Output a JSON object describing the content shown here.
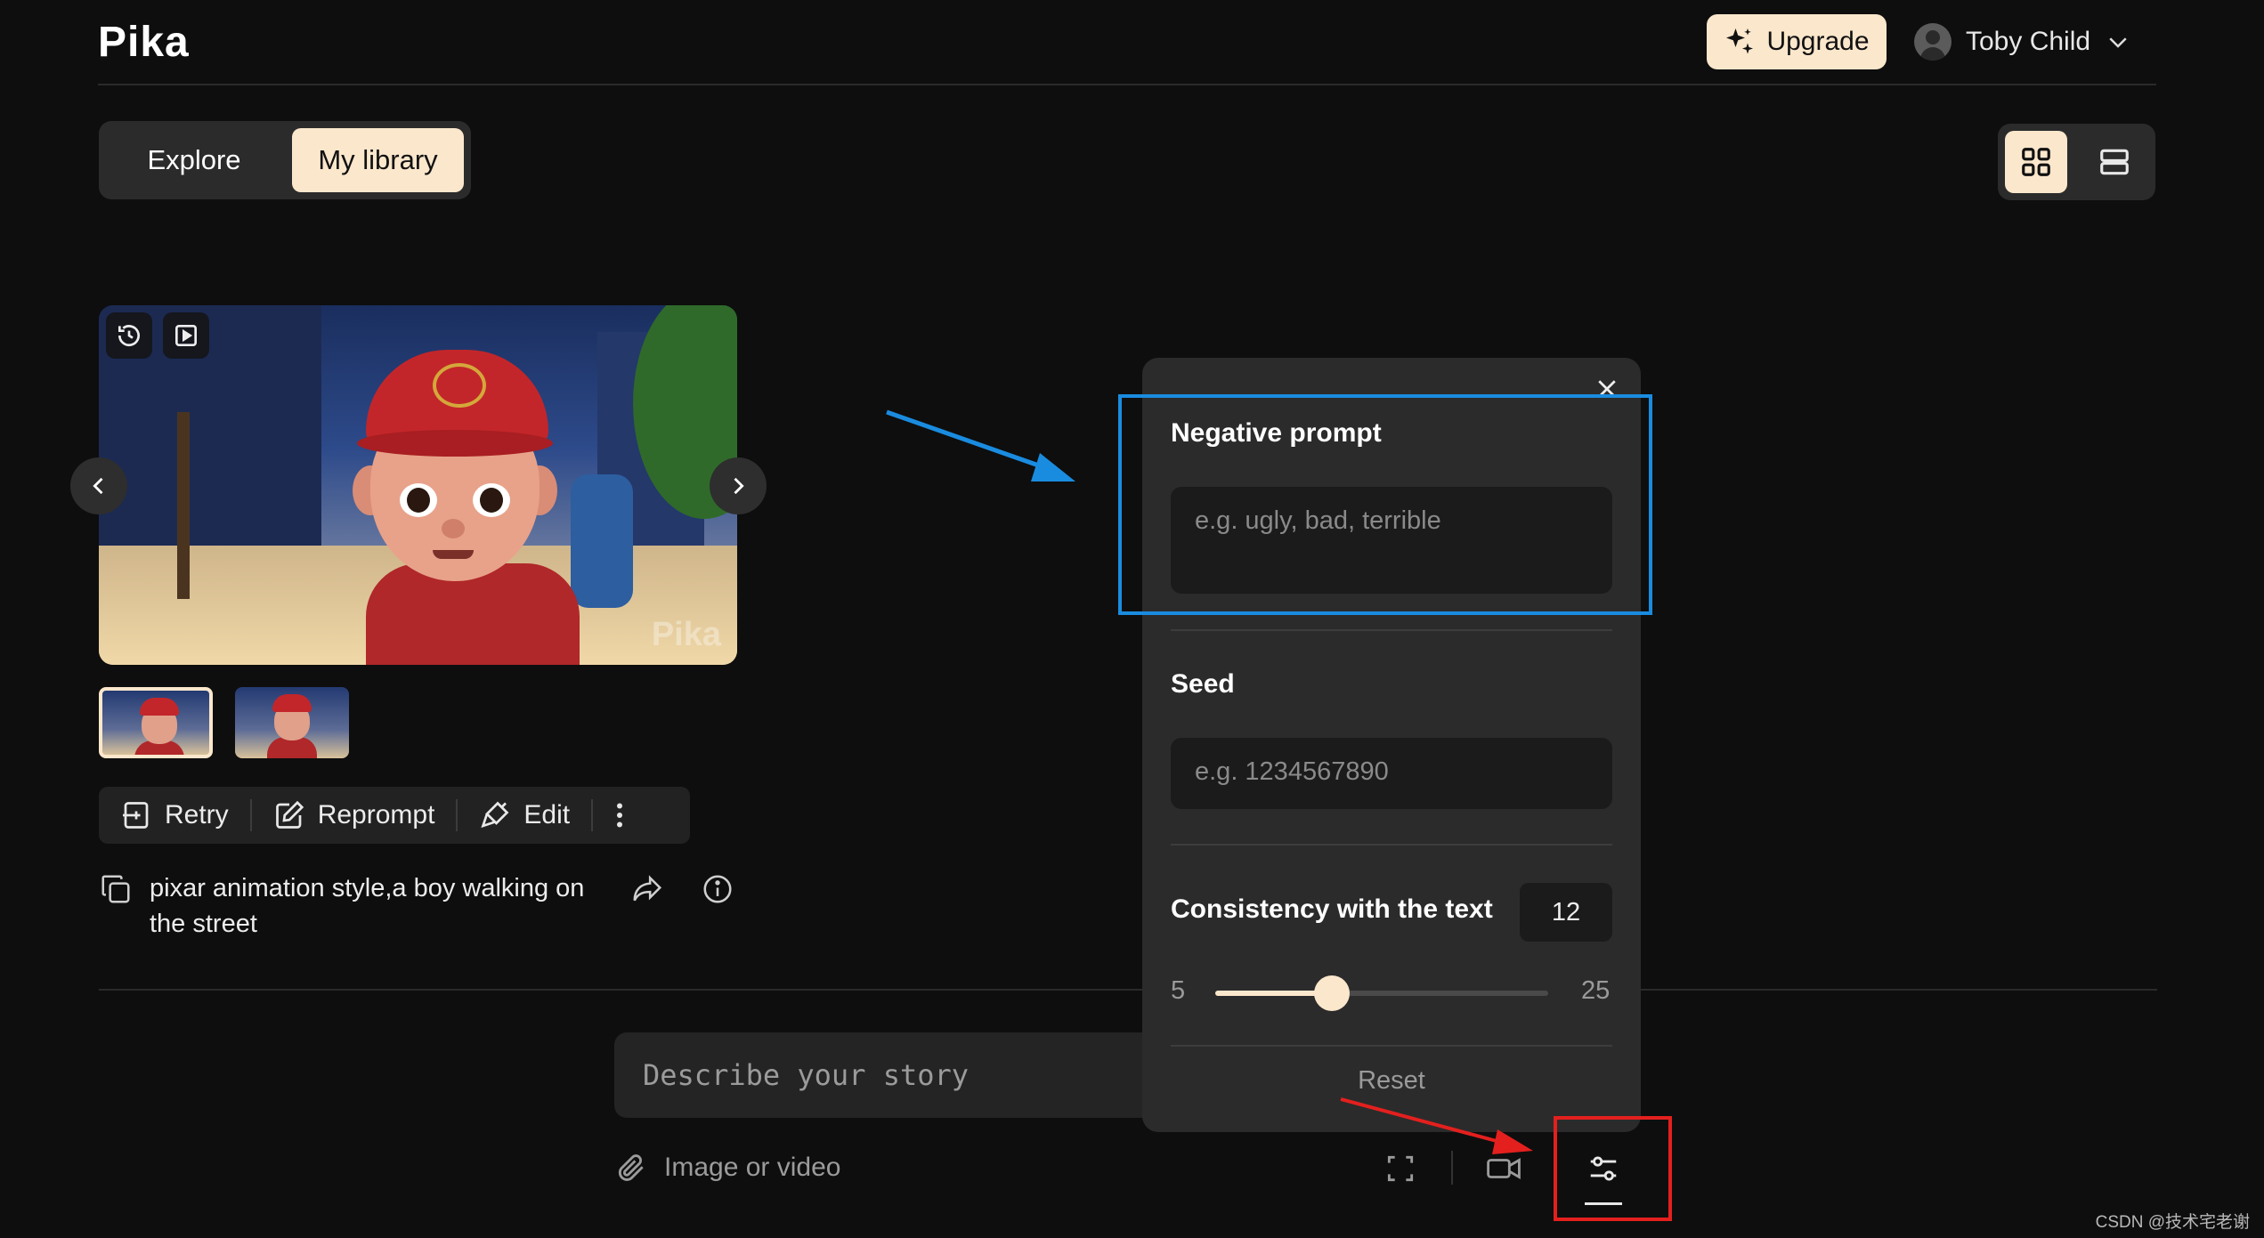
{
  "header": {
    "logo": "Pika",
    "upgrade_label": "Upgrade",
    "user_name": "Toby Child"
  },
  "tabs": [
    {
      "label": "Explore",
      "active": false
    },
    {
      "label": "My library",
      "active": true
    }
  ],
  "view_modes": [
    "grid-view",
    "list-view"
  ],
  "video": {
    "watermark": "Pika"
  },
  "actions": {
    "retry": "Retry",
    "reprompt": "Reprompt",
    "edit": "Edit"
  },
  "prompt_text": "pixar animation style,a boy walking on the street",
  "composer": {
    "placeholder": "Describe your story",
    "attach_label": "Image or video"
  },
  "panel": {
    "negative_prompt_label": "Negative prompt",
    "negative_prompt_placeholder": "e.g. ugly, bad, terrible",
    "seed_label": "Seed",
    "seed_placeholder": "e.g. 1234567890",
    "consistency_label": "Consistency with the text",
    "consistency_value": "12",
    "slider_min": "5",
    "slider_max": "25",
    "reset_label": "Reset"
  },
  "footer_watermark": "CSDN @技术宅老谢",
  "colors": {
    "accent": "#fbe7cc",
    "background": "#0e0e0e",
    "panel": "#2b2b2b",
    "annotation_blue": "#1a8ce0",
    "annotation_red": "#e3201e"
  }
}
